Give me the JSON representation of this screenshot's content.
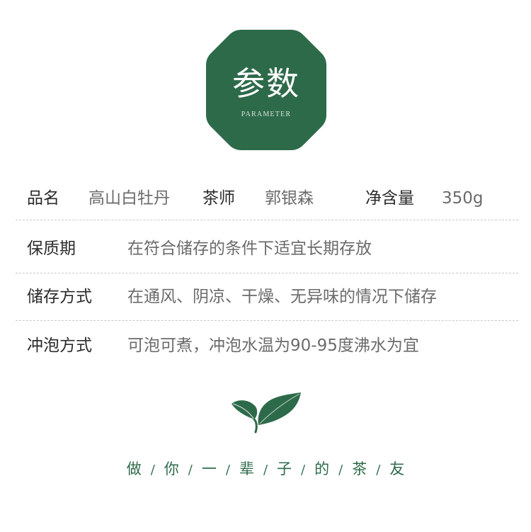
{
  "badge": {
    "title": "参数",
    "subtitle": "PARAMETER",
    "color": "#2d6a4a"
  },
  "params": {
    "row1": {
      "name_label": "品名",
      "name_value": "高山白牡丹",
      "master_label": "茶师",
      "master_value": "郭银森",
      "net_label": "净含量",
      "net_value": "350g"
    },
    "shelf_life": {
      "label": "保质期",
      "value": "在符合储存的条件下适宜长期存放"
    },
    "storage": {
      "label": "储存方式",
      "value": "在通风、阴凉、干燥、无异味的情况下储存"
    },
    "brewing": {
      "label": "冲泡方式",
      "value": "可泡可煮，冲泡水温为90-95度沸水为宜"
    }
  },
  "leaf_icon": "tea-leaf-icon",
  "slogan": {
    "chars": [
      "做",
      "你",
      "一",
      "辈",
      "子",
      "的",
      "茶",
      "友"
    ],
    "separator": "/"
  }
}
